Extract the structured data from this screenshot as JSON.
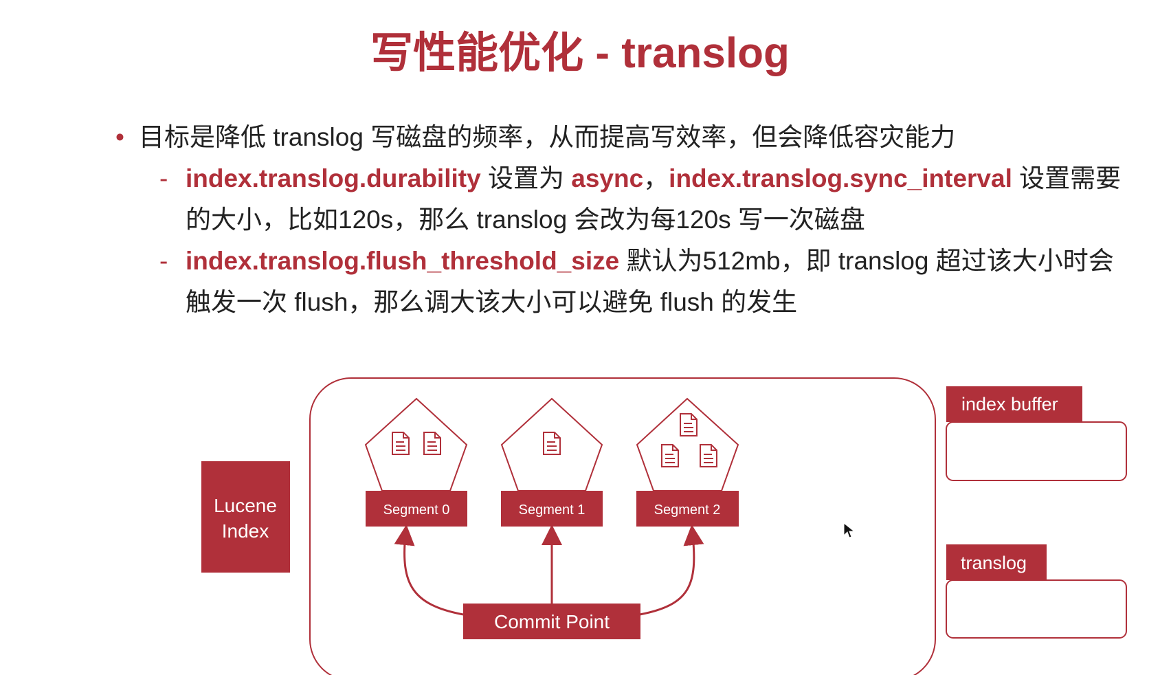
{
  "title": "写性能优化 - translog",
  "bullets": {
    "main": "目标是降低 translog 写磁盘的频率，从而提高写效率，但会降低容灾能力",
    "sub1": {
      "kw1": "index.translog.durability",
      "t1": " 设置为 ",
      "kw2": "async",
      "t2": "，",
      "kw3": "index.translog.sync_interval",
      "t3": " 设置需要的大小，比如120s，那么 translog 会改为每120s 写一次磁盘"
    },
    "sub2": {
      "kw1": "index.translog.flush_threshold_size",
      "t1": " 默认为512mb，即 translog 超过该大小时会触发一次 flush，那么调大该大小可以避免 flush 的发生"
    }
  },
  "diagram": {
    "lucene_index_line1": "Lucene",
    "lucene_index_line2": "Index",
    "segments": [
      "Segment 0",
      "Segment 1",
      "Segment 2"
    ],
    "segment_doc_counts": [
      2,
      1,
      3
    ],
    "commit_point": "Commit Point",
    "index_buffer": "index buffer",
    "translog": "translog"
  },
  "colors": {
    "accent": "#b0303a",
    "text": "#222222"
  },
  "icons": [
    "document-icon",
    "mouse-cursor-icon"
  ]
}
